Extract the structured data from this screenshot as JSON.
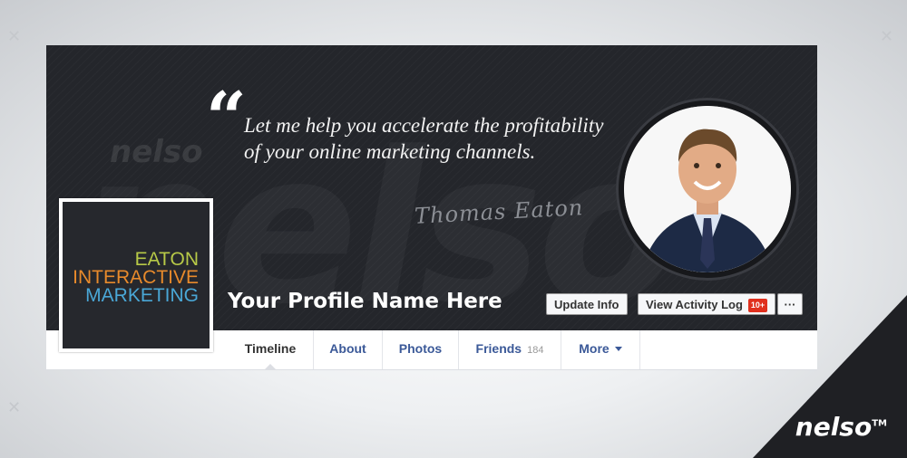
{
  "cover": {
    "quote": "Let me help you accelerate the profitability of your online marketing channels.",
    "signature": "Thomas Eaton",
    "quote_mark": "“"
  },
  "profile": {
    "name": "Your Profile Name Here",
    "logo_lines": [
      "EATON",
      "INTERACTIVE",
      "MARKETING"
    ],
    "logo_colors": [
      "#b7c947",
      "#e88a2b",
      "#4aa7d6"
    ]
  },
  "actions": {
    "update_info": "Update Info",
    "view_activity_log": "View Activity Log",
    "activity_badge": "10+",
    "more_options": "···"
  },
  "tabs": [
    {
      "label": "Timeline",
      "count": ""
    },
    {
      "label": "About",
      "count": ""
    },
    {
      "label": "Photos",
      "count": ""
    },
    {
      "label": "Friends",
      "count": "184"
    },
    {
      "label": "More",
      "count": ""
    }
  ],
  "branding": {
    "watermark": "nelso",
    "corner_logo": "nelso",
    "trademark": "TM"
  },
  "colors": {
    "cover_bg": "#24262b",
    "link_blue": "#3b5998",
    "badge_red": "#e0301e"
  }
}
